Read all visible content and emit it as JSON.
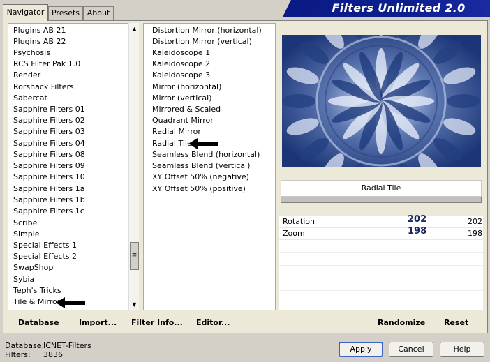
{
  "tabs": [
    "Navigator",
    "Presets",
    "About"
  ],
  "banner": {
    "title": "Filters Unlimited 2.0"
  },
  "categories": [
    "Plugins AB 21",
    "Plugins AB 22",
    "Psychosis",
    "RCS Filter Pak 1.0",
    "Render",
    "Rorshack Filters",
    "Sabercat",
    "Sapphire Filters 01",
    "Sapphire Filters 02",
    "Sapphire Filters 03",
    "Sapphire Filters 04",
    "Sapphire Filters 08",
    "Sapphire Filters 09",
    "Sapphire Filters 10",
    "Sapphire Filters 1a",
    "Sapphire Filters 1b",
    "Sapphire Filters 1c",
    "Scribe",
    "Simple",
    "Special Effects 1",
    "Special Effects 2",
    "SwapShop",
    "Sybia",
    "Teph's Tricks",
    "Tile & Mirror"
  ],
  "selected_category": "Tile & Mirror",
  "filters": [
    "Distortion Mirror (horizontal)",
    "Distortion Mirror (vertical)",
    "Kaleidoscope 1",
    "Kaleidoscope 2",
    "Kaleidoscope 3",
    "Mirror (horizontal)",
    "Mirror (vertical)",
    "Mirrored & Scaled",
    "Quadrant Mirror",
    "Radial Mirror",
    "Radial Tile",
    "Seamless Blend (horizontal)",
    "Seamless Blend (vertical)",
    "XY Offset 50% (negative)",
    "XY Offset 50% (positive)"
  ],
  "selected_filter": "Radial Tile",
  "effect_name": "Radial Tile",
  "params": [
    {
      "label": "Rotation",
      "big_value": "202",
      "value": "202"
    },
    {
      "label": "Zoom",
      "big_value": "198",
      "value": "198"
    }
  ],
  "bottom_links": {
    "database": "Database",
    "import": "Import...",
    "filter_info": "Filter Info...",
    "editor": "Editor...",
    "randomize": "Randomize",
    "reset": "Reset"
  },
  "status": {
    "database_label": "Database:",
    "database_value": "ICNET-Filters",
    "filters_label": "Filters:",
    "filters_value": "3836"
  },
  "buttons": {
    "apply": "Apply",
    "cancel": "Cancel",
    "help": "Help"
  }
}
